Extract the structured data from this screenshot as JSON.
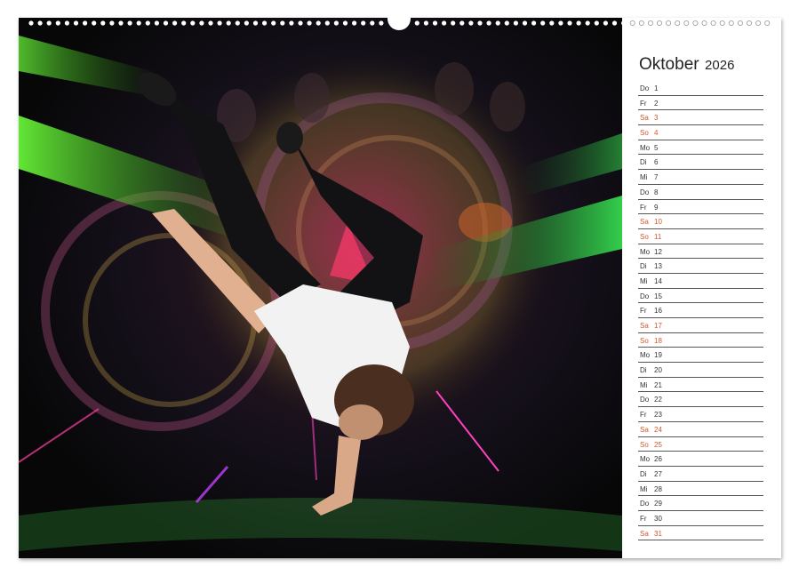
{
  "calendar": {
    "month": "Oktober",
    "year": "2026",
    "weekend_color": "#d4582a",
    "days": [
      {
        "wd": "Do",
        "d": "1",
        "we": false
      },
      {
        "wd": "Fr",
        "d": "2",
        "we": false
      },
      {
        "wd": "Sa",
        "d": "3",
        "we": true
      },
      {
        "wd": "So",
        "d": "4",
        "we": true
      },
      {
        "wd": "Mo",
        "d": "5",
        "we": false
      },
      {
        "wd": "Di",
        "d": "6",
        "we": false
      },
      {
        "wd": "Mi",
        "d": "7",
        "we": false
      },
      {
        "wd": "Do",
        "d": "8",
        "we": false
      },
      {
        "wd": "Fr",
        "d": "9",
        "we": false
      },
      {
        "wd": "Sa",
        "d": "10",
        "we": true
      },
      {
        "wd": "So",
        "d": "11",
        "we": true
      },
      {
        "wd": "Mo",
        "d": "12",
        "we": false
      },
      {
        "wd": "Di",
        "d": "13",
        "we": false
      },
      {
        "wd": "Mi",
        "d": "14",
        "we": false
      },
      {
        "wd": "Do",
        "d": "15",
        "we": false
      },
      {
        "wd": "Fr",
        "d": "16",
        "we": false
      },
      {
        "wd": "Sa",
        "d": "17",
        "we": true
      },
      {
        "wd": "So",
        "d": "18",
        "we": true
      },
      {
        "wd": "Mo",
        "d": "19",
        "we": false
      },
      {
        "wd": "Di",
        "d": "20",
        "we": false
      },
      {
        "wd": "Mi",
        "d": "21",
        "we": false
      },
      {
        "wd": "Do",
        "d": "22",
        "we": false
      },
      {
        "wd": "Fr",
        "d": "23",
        "we": false
      },
      {
        "wd": "Sa",
        "d": "24",
        "we": true
      },
      {
        "wd": "So",
        "d": "25",
        "we": true
      },
      {
        "wd": "Mo",
        "d": "26",
        "we": false
      },
      {
        "wd": "Di",
        "d": "27",
        "we": false
      },
      {
        "wd": "Mi",
        "d": "28",
        "we": false
      },
      {
        "wd": "Do",
        "d": "29",
        "we": false
      },
      {
        "wd": "Fr",
        "d": "30",
        "we": false
      },
      {
        "wd": "Sa",
        "d": "31",
        "we": true
      }
    ]
  }
}
